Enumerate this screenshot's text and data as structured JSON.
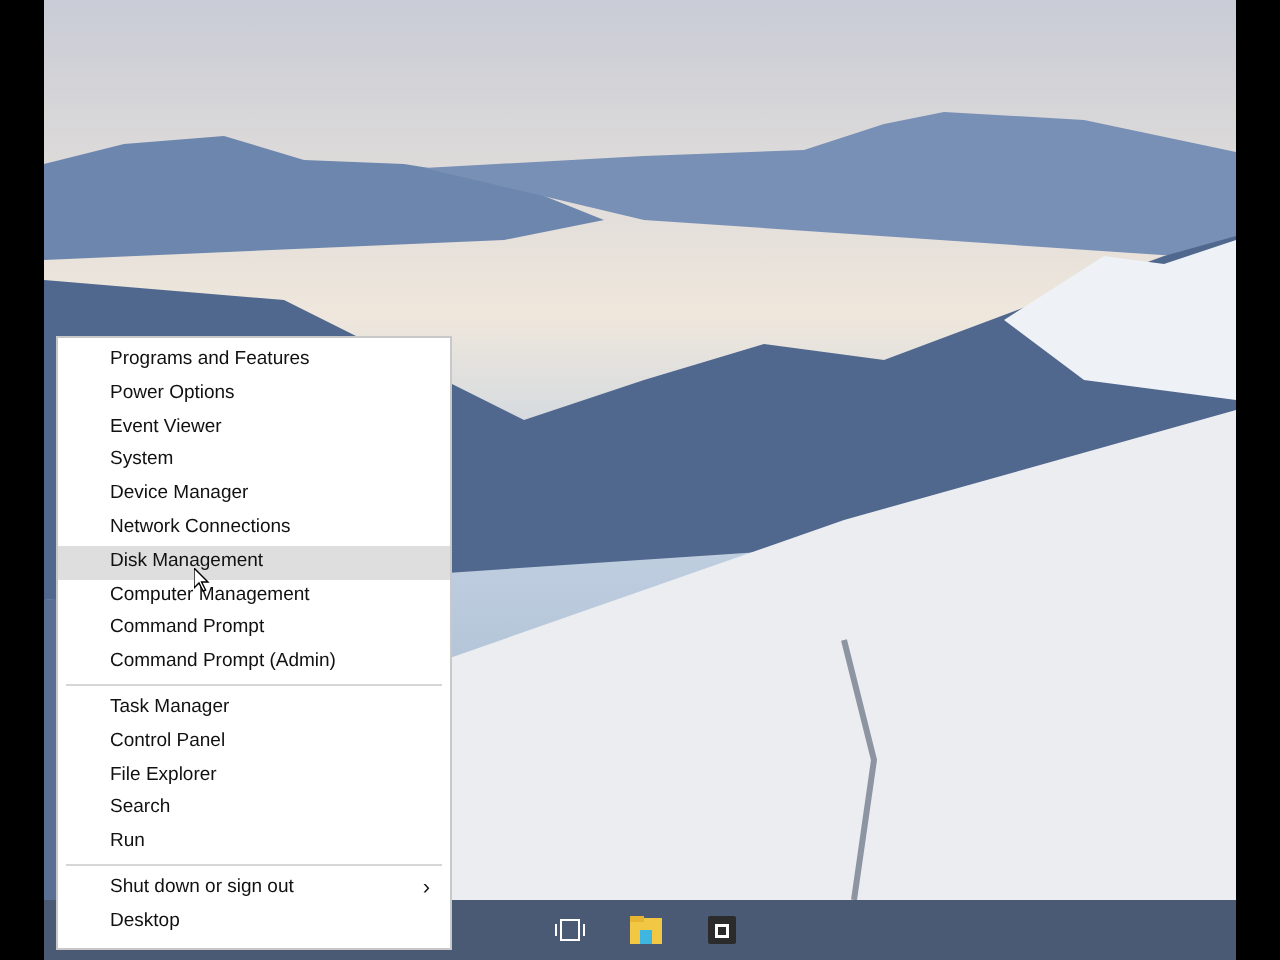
{
  "context_menu": {
    "sections": [
      {
        "items": [
          {
            "label": "Programs and Features",
            "selected": false
          },
          {
            "label": "Power Options",
            "selected": false
          },
          {
            "label": "Event Viewer",
            "selected": false
          },
          {
            "label": "System",
            "selected": false
          },
          {
            "label": "Device Manager",
            "selected": false
          },
          {
            "label": "Network Connections",
            "selected": false
          },
          {
            "label": "Disk Management",
            "selected": true
          },
          {
            "label": "Computer Management",
            "selected": false
          },
          {
            "label": "Command Prompt",
            "selected": false
          },
          {
            "label": "Command Prompt (Admin)",
            "selected": false
          }
        ]
      },
      {
        "items": [
          {
            "label": "Task Manager",
            "selected": false
          },
          {
            "label": "Control Panel",
            "selected": false
          },
          {
            "label": "File Explorer",
            "selected": false
          },
          {
            "label": "Search",
            "selected": false
          },
          {
            "label": "Run",
            "selected": false
          }
        ]
      },
      {
        "items": [
          {
            "label": "Shut down or sign out",
            "selected": false,
            "submenu": "›"
          },
          {
            "label": "Desktop",
            "selected": false
          }
        ]
      }
    ]
  }
}
